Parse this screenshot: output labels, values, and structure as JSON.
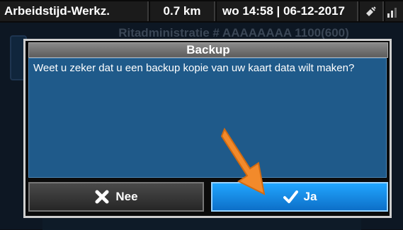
{
  "statusbar": {
    "title": "Arbeidstijd-Werkz.",
    "distance": "0.7 km",
    "datetime": "wo 14:58 | 06-12-2017"
  },
  "background": {
    "header_text": "Ritadministratie # AAAAAAAA 1100(600)"
  },
  "dialog": {
    "title": "Backup",
    "message": "Weet u zeker dat u een backup kopie van uw kaart data wilt maken?",
    "buttons": {
      "no_label": "Nee",
      "yes_label": "Ja"
    }
  },
  "icons": {
    "no_icon": "close-icon",
    "yes_icon": "checkmark-icon",
    "status_icon_1": "satellite-icon",
    "status_icon_2": "signal-icon"
  },
  "colors": {
    "dialog_body": "#1f5a8a",
    "yes_button": "#1a8fe8",
    "no_button": "#3a3a3a",
    "annotation_arrow": "#f28a2b"
  }
}
